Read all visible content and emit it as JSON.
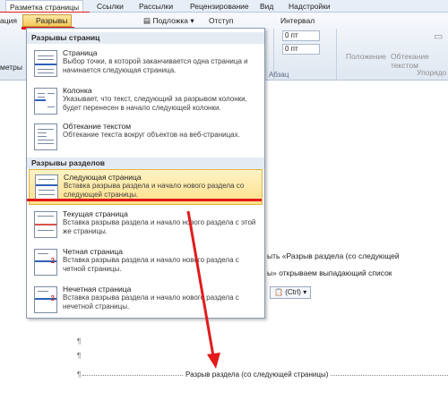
{
  "tabs": [
    "Разметка страницы",
    "Ссылки",
    "Рассылки",
    "Рецензирование",
    "Вид",
    "Надстройки"
  ],
  "ribbon": {
    "breaks_label": "Разрывы",
    "orientation_fragment": "ация",
    "meters_fragment": "метры",
    "watermark_label": "Подложка",
    "indent_label": "Отступ",
    "interval_label": "Интервал",
    "spacing_before": "0 пт",
    "spacing_after": "0 пт",
    "paragraph_group": "Абзац",
    "position_label": "Положение",
    "wrap_label": "Обтекание текстом",
    "arrange_fragment": "Упорядо"
  },
  "menu": {
    "page_breaks_header": "Разрывы страниц",
    "section_breaks_header": "Разрывы разделов",
    "items": [
      {
        "title": "Страница",
        "desc": "Выбор точки, в которой заканчивается одна страница и начинается следующая страница."
      },
      {
        "title": "Колонка",
        "desc": "Указывает, что текст, следующий за разрывом колонки, будет перенесен в начало следующей колонки."
      },
      {
        "title": "Обтекание текстом",
        "desc": "Обтекание текста вокруг объектов на веб-страницах."
      },
      {
        "title": "Следующая страница",
        "desc": "Вставка разрыва раздела и начало нового раздела со следующей страницы."
      },
      {
        "title": "Текущая страница",
        "desc": "Вставка разрыва раздела и начало нового раздела с этой же страницы."
      },
      {
        "title": "Четная страница",
        "desc": "Вставка разрыва раздела и начало нового раздела с четной страницы."
      },
      {
        "title": "Нечетная страница",
        "desc": "Вставка разрыва раздела и начало нового раздела с нечетной страницы."
      }
    ]
  },
  "document": {
    "line1": "ыть «Разрыв раздела (со следующей",
    "line2": "ы» открываем выпадающий список",
    "ctrl_label": "(Ctrl)",
    "pilcrow": "¶",
    "section_break_label": "Разрыв раздела (со следующей страницы)"
  },
  "colors": {
    "highlight": "#ffe08a",
    "annotation": "#e21b1b"
  }
}
